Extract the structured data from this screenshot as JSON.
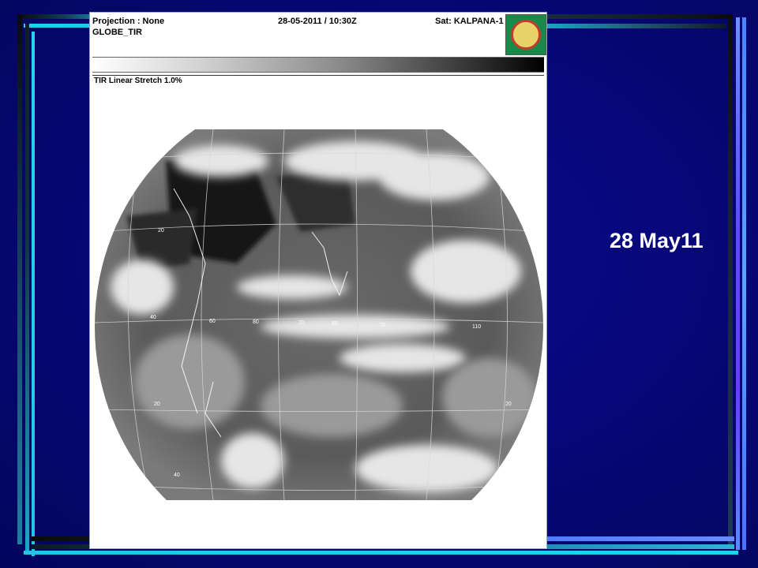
{
  "slide": {
    "date_label": "28 May11"
  },
  "satellite_image": {
    "projection": "Projection : None",
    "product": "GLOBE_TIR",
    "timestamp": "28-05-2011 / 10:30Z",
    "satellite": "Sat: KALPANA-1",
    "stretch": "TIR Linear Stretch 1.0%",
    "grid_labels": [
      "20",
      "40",
      "60",
      "70",
      "80",
      "60",
      "70",
      "110",
      "20",
      "40",
      "20"
    ]
  }
}
